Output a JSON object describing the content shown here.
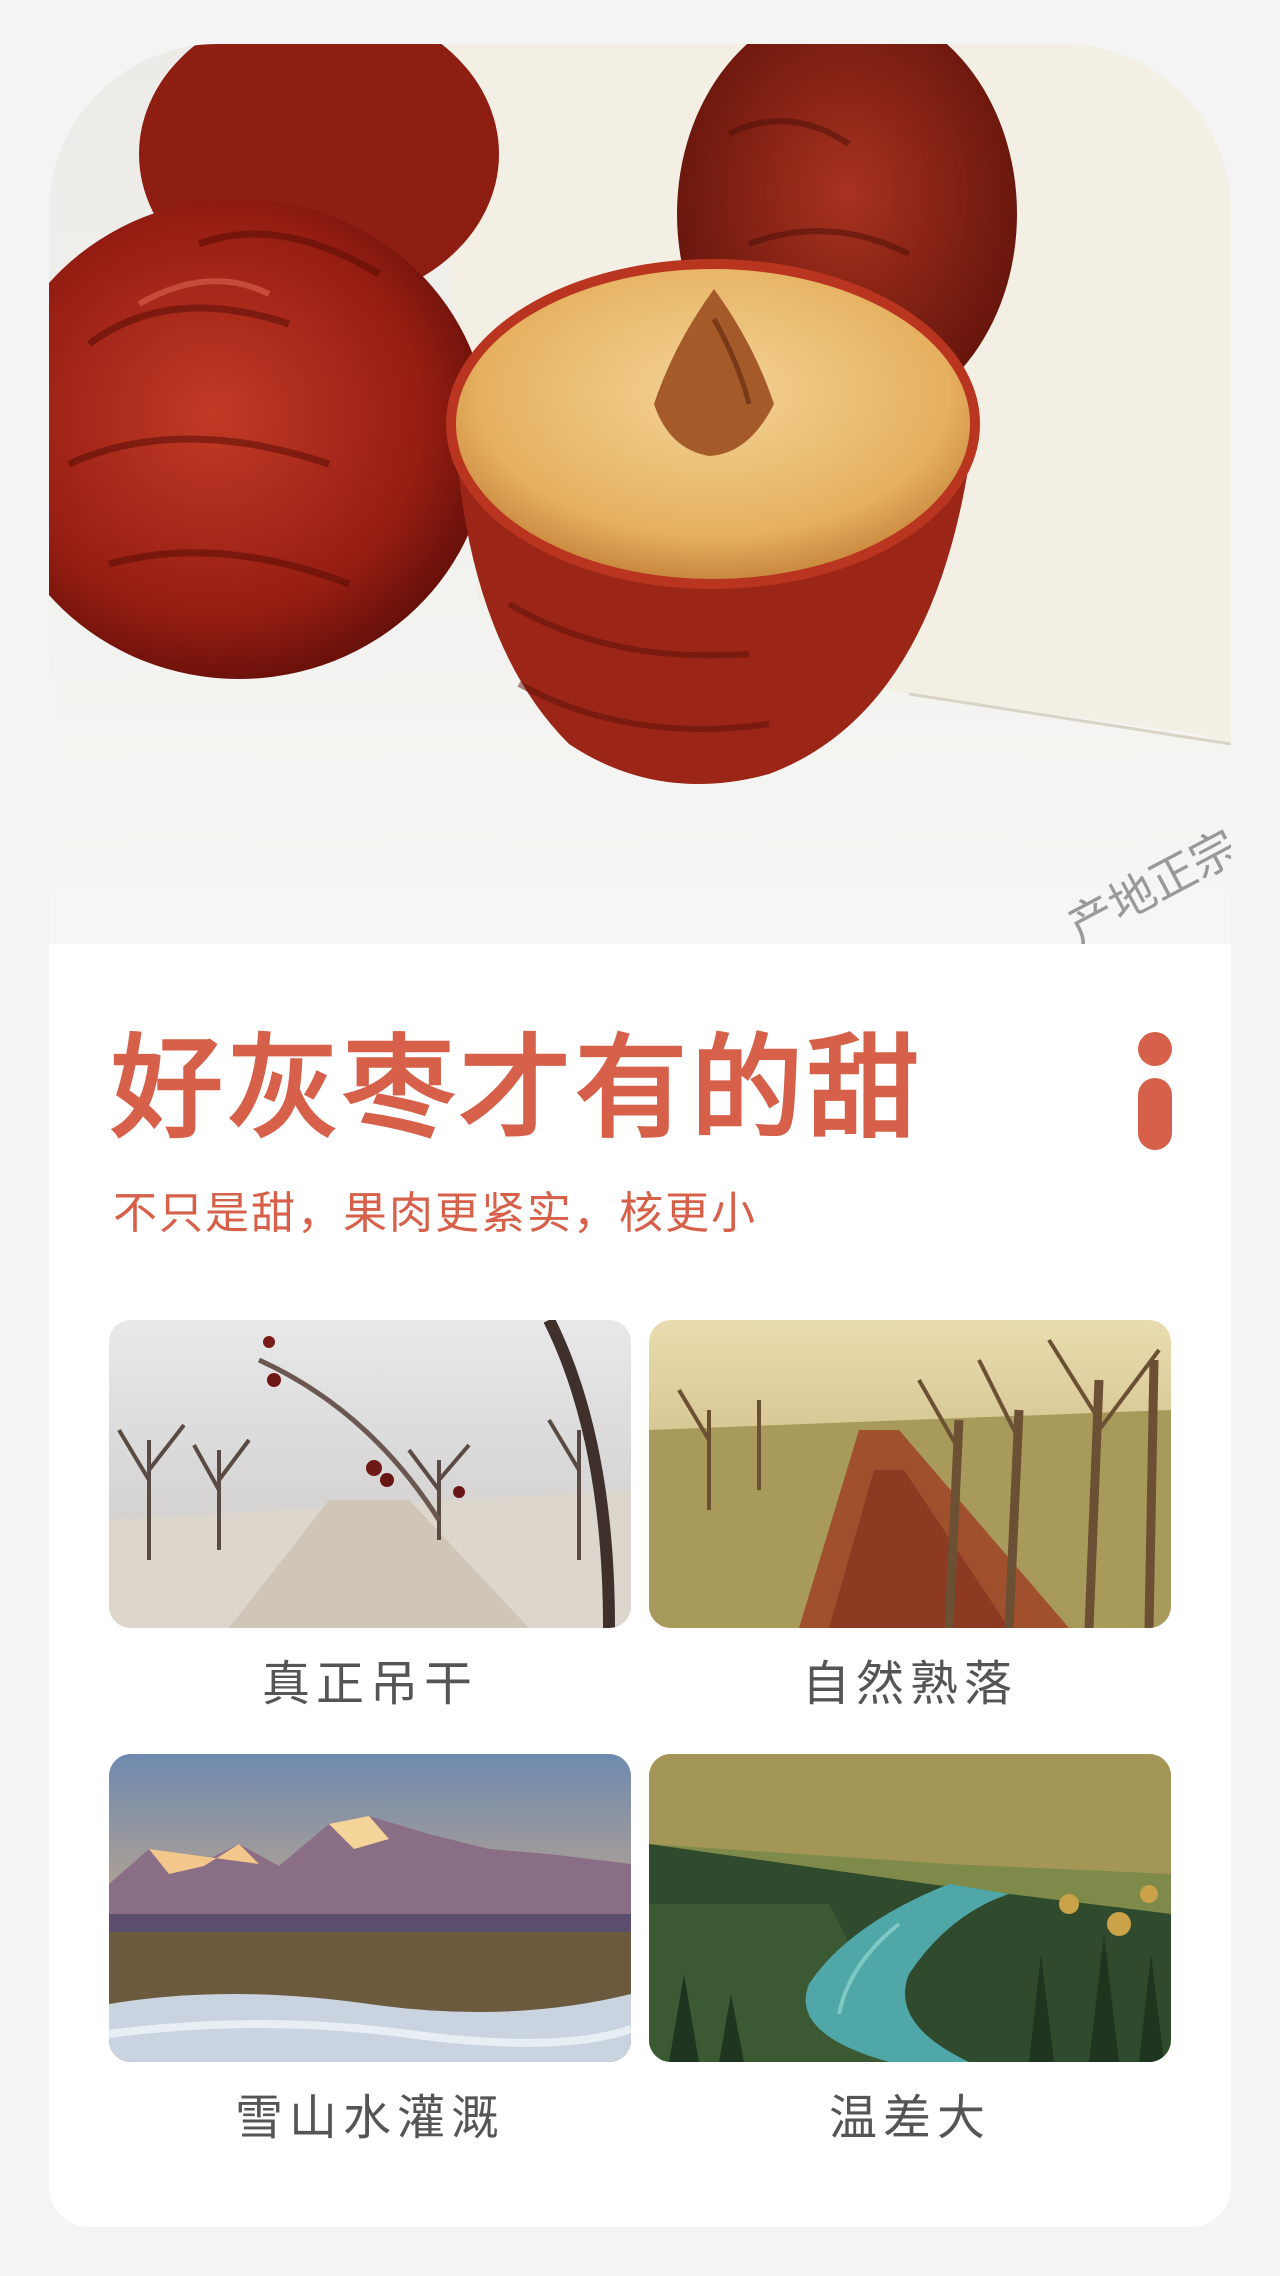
{
  "hero": {
    "image": "red-jujube-dates-photo",
    "print_text": "产地正宗"
  },
  "headline": {
    "title": "好灰枣才有的甜",
    "subtitle": "不只是甜，果肉更紧实，核更小",
    "info_icon": "info-icon"
  },
  "features": [
    {
      "label": "真正吊干",
      "image": "bare-jujube-orchard-winter-photo"
    },
    {
      "label": "自然熟落",
      "image": "fallen-dates-orchard-path-photo"
    },
    {
      "label": "雪山水灌溉",
      "image": "snow-mountain-plain-photo"
    },
    {
      "label": "温差大",
      "image": "river-valley-forest-photo"
    }
  ],
  "colors": {
    "accent": "#d6604a",
    "caption": "#555555",
    "background": "#f4f4f4",
    "card": "#ffffff"
  }
}
